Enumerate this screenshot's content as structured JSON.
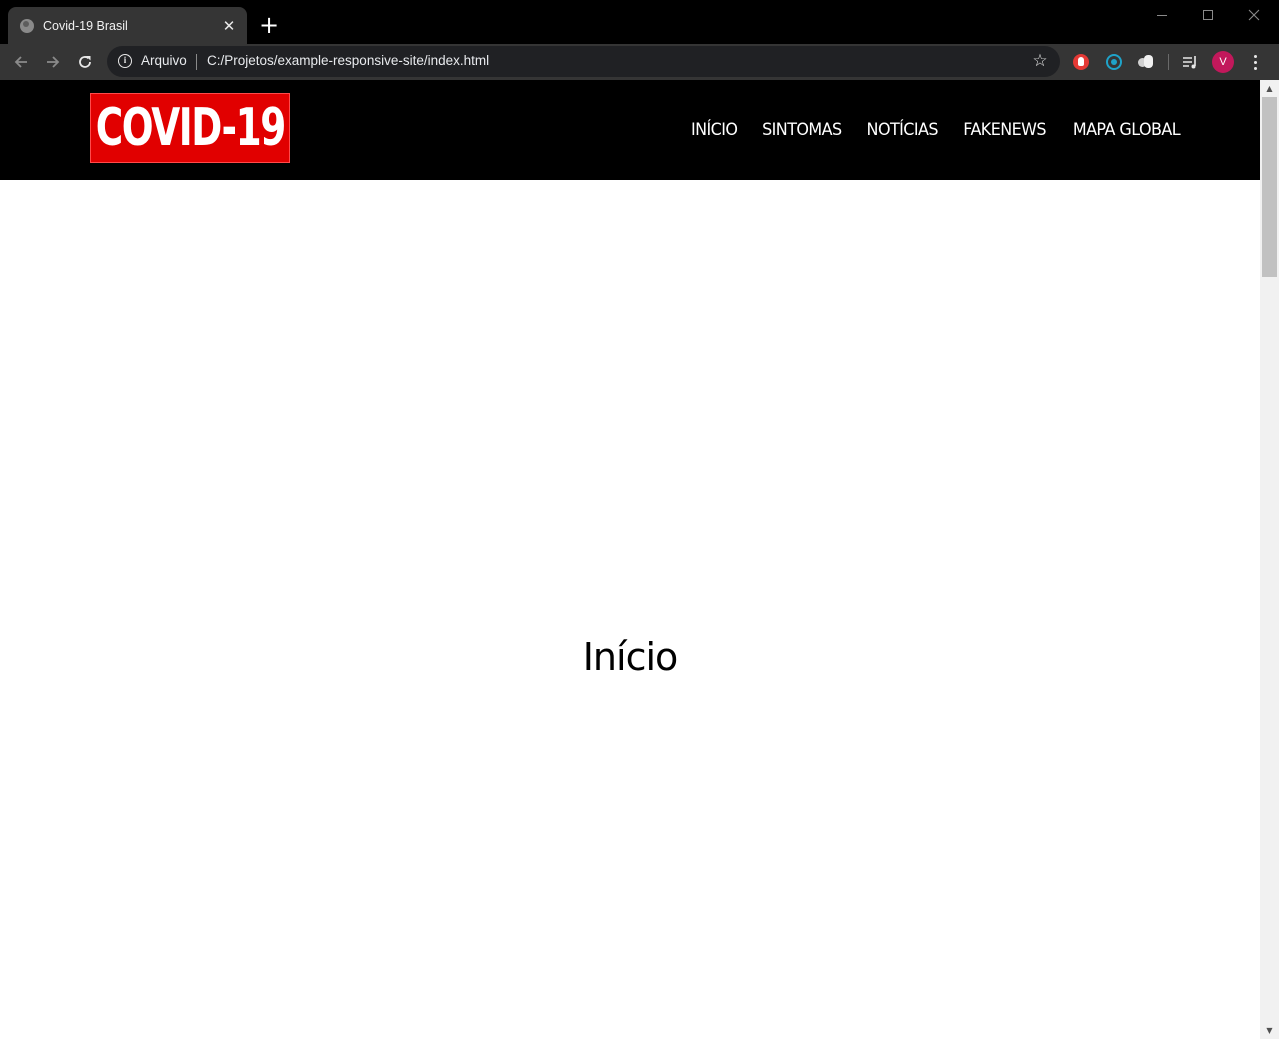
{
  "browser": {
    "tab": {
      "title": "Covid-19 Brasil",
      "favicon": "globe-icon",
      "close_glyph": "✕"
    },
    "new_tab_glyph": "+",
    "omnibox": {
      "scheme_label": "Arquivo",
      "url": "C:/Projetos/example-responsive-site/index.html",
      "star_glyph": "☆"
    },
    "profile_initial": "V",
    "extensions": [
      "ad-block-icon",
      "react-devtools-icon",
      "extension-puzzle-icon"
    ]
  },
  "site": {
    "logo_text": "COVID-19",
    "nav": [
      {
        "label": "INÍCIO"
      },
      {
        "label": "SINTOMAS"
      },
      {
        "label": "NOTÍCIAS"
      },
      {
        "label": "FAKENEWS"
      },
      {
        "label": "MAPA GLOBAL"
      }
    ],
    "heading": "Início"
  },
  "colors": {
    "header_bg": "#000000",
    "logo_bg": "#e10000",
    "profile_avatar": "#c2185b"
  }
}
